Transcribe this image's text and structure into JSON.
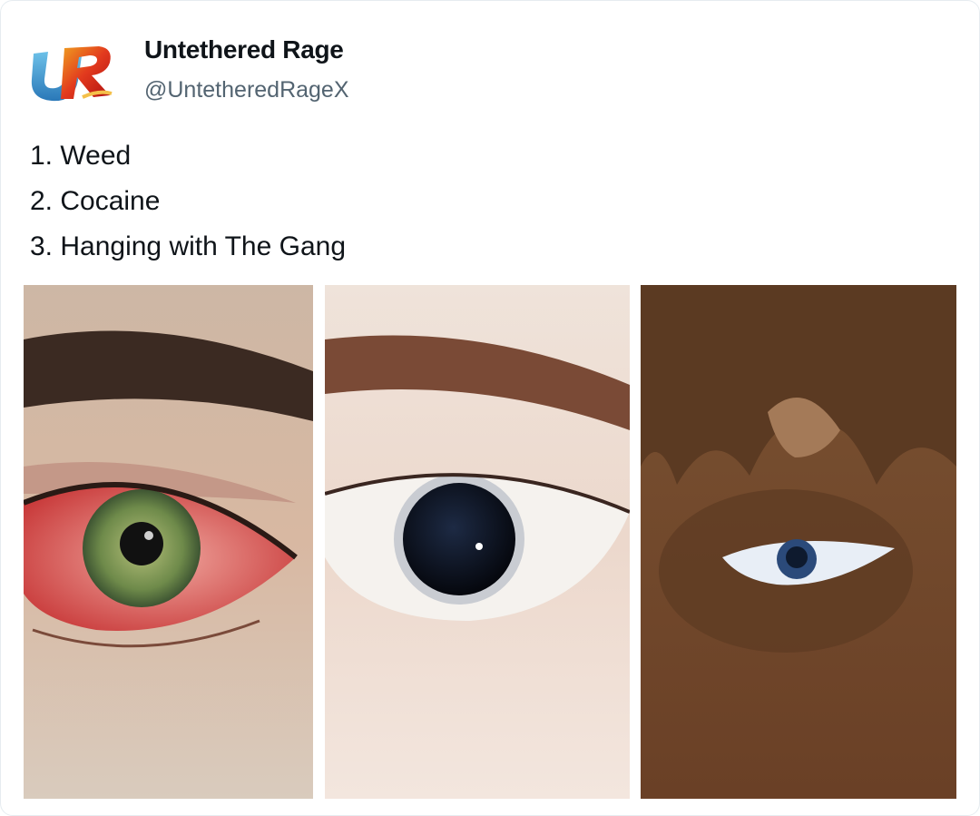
{
  "tweet": {
    "author_name": "Untethered Rage",
    "author_handle": "@UntetheredRageX",
    "avatar_text": "UR",
    "lines": [
      "1. Weed",
      "2. Cocaine",
      "3. Hanging with The Gang"
    ]
  },
  "media": [
    {
      "icon": "bloodshot-eye-photo"
    },
    {
      "icon": "dilated-pupil-eye-photo"
    },
    {
      "icon": "cartoon-eye-photo"
    }
  ],
  "colors": {
    "name": "#0f1419",
    "handle": "#536471",
    "border": "#e6ecf0"
  }
}
